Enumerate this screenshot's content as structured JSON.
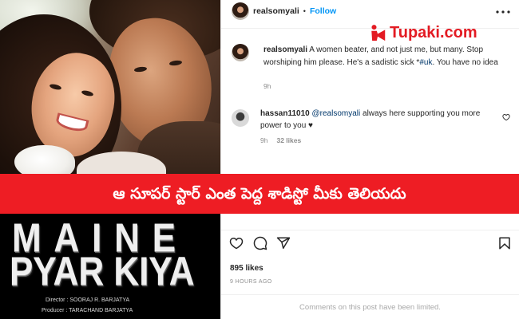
{
  "poster": {
    "title_line1": "MAINE",
    "title_line2": "PYAR KIYA",
    "credits": [
      "Director : SOORAJ R. BARJATYA",
      "Producer : TARACHAND BARJATYA"
    ]
  },
  "watermark": {
    "brand": "Tupaki.com",
    "icon": "tupaki-logo-icon",
    "color": "#e31b23"
  },
  "banner": {
    "text": "ఆ సూపర్ స్టార్ ఎంత పెద్ద శాడిస్టో మీకు తెలియదు",
    "background": "#ee1d24",
    "color": "#ffffff"
  },
  "post": {
    "header": {
      "username": "realsomyali",
      "separator": "•",
      "follow_label": "Follow",
      "more_icon": "more-options-icon"
    },
    "caption": {
      "username": "realsomyali",
      "text_before_hashtag": "A women beater, and not just me, but many. Stop worshiping him please. He's a sadistic sick *",
      "hashtag": "#uk",
      "text_after_hashtag": ". You have no idea",
      "time": "9h"
    },
    "comment": {
      "username": "hassan11010",
      "mention": "@realsomyali",
      "text": "always here supporting you more power to you ♥",
      "time": "9h",
      "likes": "32 likes",
      "like_icon": "heart-outline-icon"
    },
    "actions": {
      "like_icon": "heart-outline-icon",
      "comment_icon": "comment-bubble-icon",
      "share_icon": "paper-plane-icon",
      "save_icon": "bookmark-icon"
    },
    "likes": "895 likes",
    "timestamp": "9 HOURS AGO",
    "comments_notice": "Comments on this post have been limited."
  },
  "colors": {
    "follow": "#0095f6",
    "link": "#00376b",
    "muted": "#8e8e8e",
    "divider": "#efefef",
    "text": "#262626"
  }
}
